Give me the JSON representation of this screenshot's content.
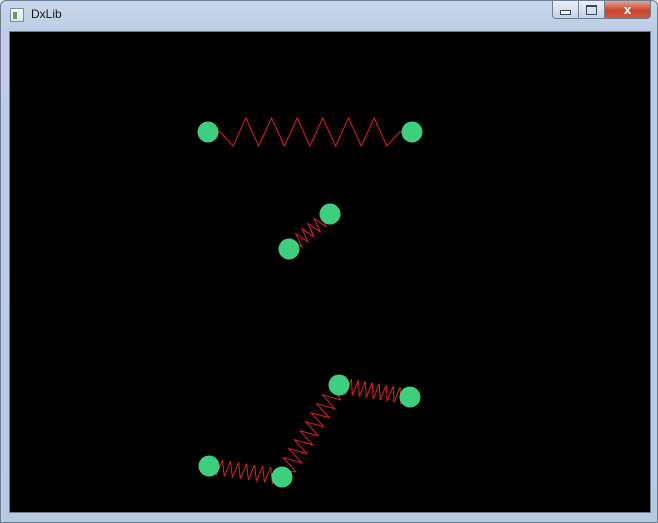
{
  "window": {
    "title": "DxLib",
    "minimize_icon": "minimize-icon",
    "maximize_icon": "maximize-icon",
    "close_label": "x"
  },
  "colors": {
    "background": "#000000",
    "spring": "#e8201a",
    "mass": "#3ccf7e"
  }
}
